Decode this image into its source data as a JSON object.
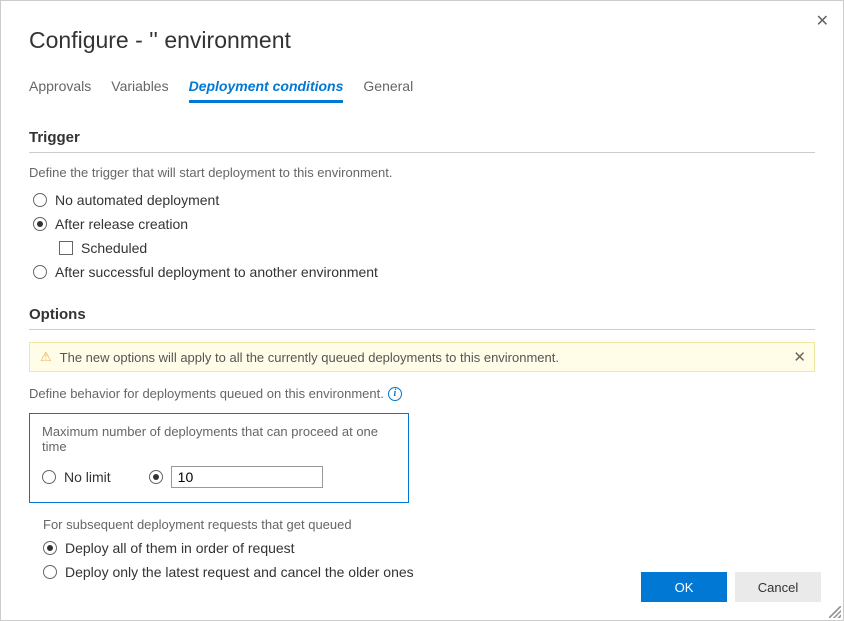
{
  "dialog": {
    "title": "Configure - '' environment",
    "close": "✕"
  },
  "tabs": {
    "approvals": "Approvals",
    "variables": "Variables",
    "deployment_conditions": "Deployment conditions",
    "general": "General"
  },
  "trigger": {
    "title": "Trigger",
    "description": "Define the trigger that will start deployment to this environment.",
    "no_automated": "No automated deployment",
    "after_release": "After release creation",
    "scheduled": "Scheduled",
    "after_successful": "After successful deployment to another environment"
  },
  "options": {
    "title": "Options",
    "warning": "The new options will apply to all the currently queued deployments to this environment.",
    "description": "Define behavior for deployments queued on this environment.",
    "max_label": "Maximum number of deployments that can proceed at one time",
    "no_limit": "No limit",
    "limit_value": "10",
    "subsequent_label": "For subsequent deployment requests that get queued",
    "deploy_all": "Deploy all of them in order of request",
    "deploy_latest": "Deploy only the latest request and cancel the older ones"
  },
  "buttons": {
    "ok": "OK",
    "cancel": "Cancel"
  }
}
